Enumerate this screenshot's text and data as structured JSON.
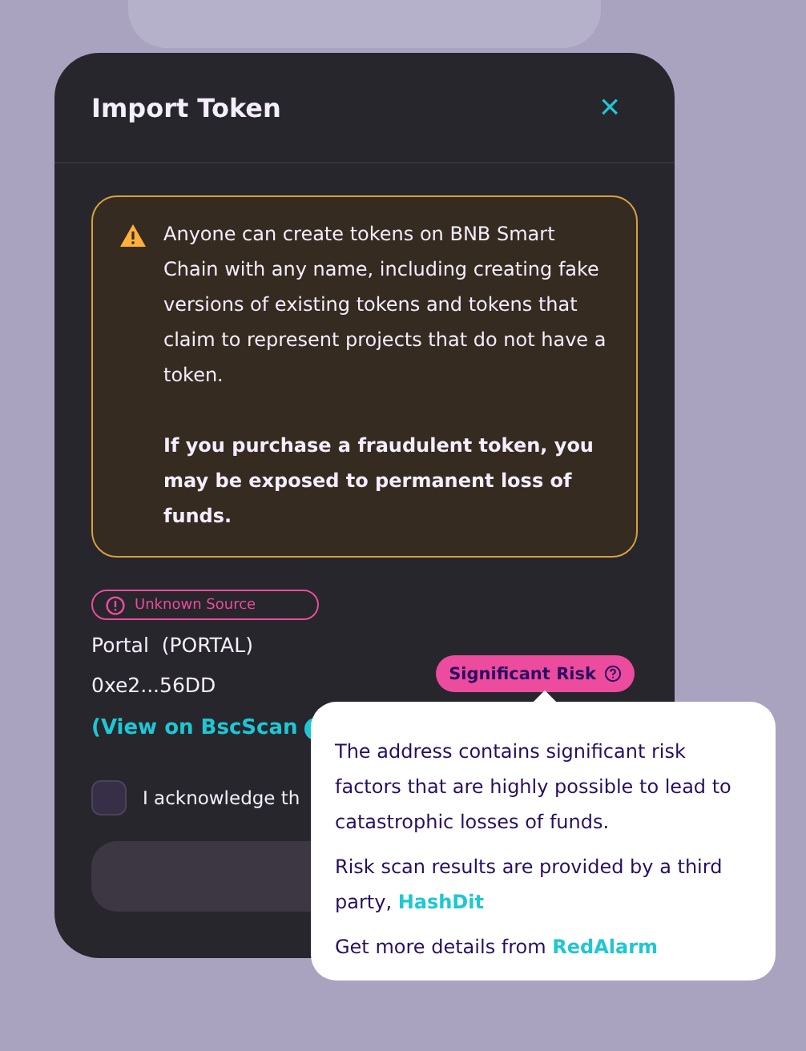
{
  "modal": {
    "title": "Import Token",
    "close": "×"
  },
  "warning": {
    "text": "Anyone can create tokens on BNB Smart Chain with any name, including creating fake versions of existing tokens and tokens that claim to represent projects that do not have a token.",
    "emphasis": "If you purchase a fraudulent token, you may be exposed to permanent loss of funds."
  },
  "token": {
    "source_badge": "Unknown Source",
    "name": "Portal  (PORTAL)",
    "address": "0xe2...56DD",
    "explorer_link": "(View on BscScan",
    "risk_badge": "Significant Risk"
  },
  "acknowledge": {
    "label": "I acknowledge th",
    "checked": false
  },
  "import_button": {
    "disabled": true
  },
  "tooltip": {
    "paragraphs": [
      {
        "text": "The address contains significant risk factors that are highly possible to lead to catastrophic losses of funds."
      },
      {
        "text": "Risk scan results are provided by a third party, ",
        "link": "HashDit"
      },
      {
        "text": "Get more details from ",
        "link": "RedAlarm"
      }
    ]
  }
}
